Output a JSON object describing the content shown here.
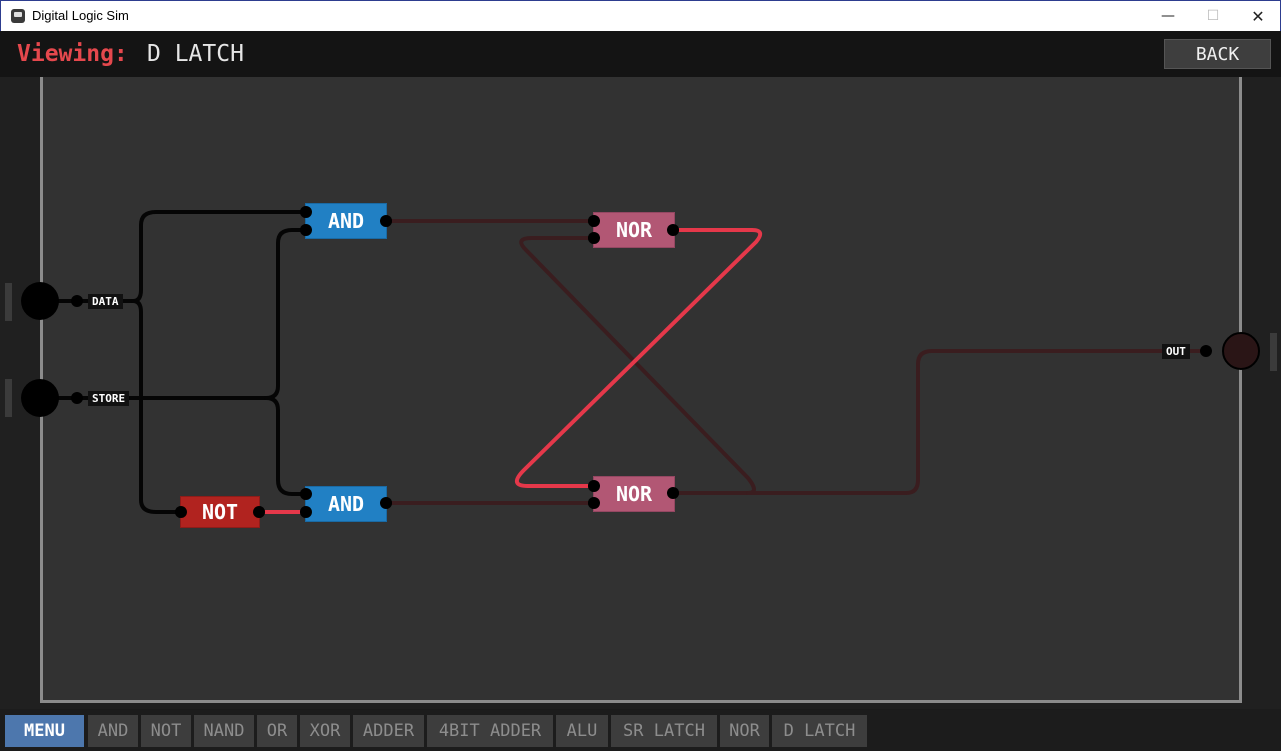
{
  "window": {
    "title": "Digital Logic Sim",
    "minimize": "—",
    "maximize": "☐",
    "close": "✕"
  },
  "header": {
    "viewing_label": "Viewing:",
    "chip_name": "D LATCH",
    "back_label": "BACK"
  },
  "circuit": {
    "inputs": [
      {
        "label": "DATA",
        "state": "off"
      },
      {
        "label": "STORE",
        "state": "off"
      }
    ],
    "outputs": [
      {
        "label": "OUT",
        "state": "off"
      }
    ],
    "chips": {
      "and_top": "AND",
      "and_bottom": "AND",
      "nor_top": "NOR",
      "nor_bottom": "NOR",
      "not": "NOT"
    }
  },
  "colors": {
    "wire_on": "#e5384a",
    "wire_off": "#3a1d1f",
    "wire_neutral": "#050505",
    "and_chip": "#2180c4",
    "nor_chip": "#b25774",
    "not_chip": "#b1231f"
  },
  "toolbar": {
    "menu": "MENU",
    "items": [
      "AND",
      "NOT",
      "NAND",
      "OR",
      "XOR",
      "ADDER",
      "4BIT ADDER",
      "ALU",
      "SR LATCH",
      "NOR",
      "D LATCH"
    ]
  }
}
